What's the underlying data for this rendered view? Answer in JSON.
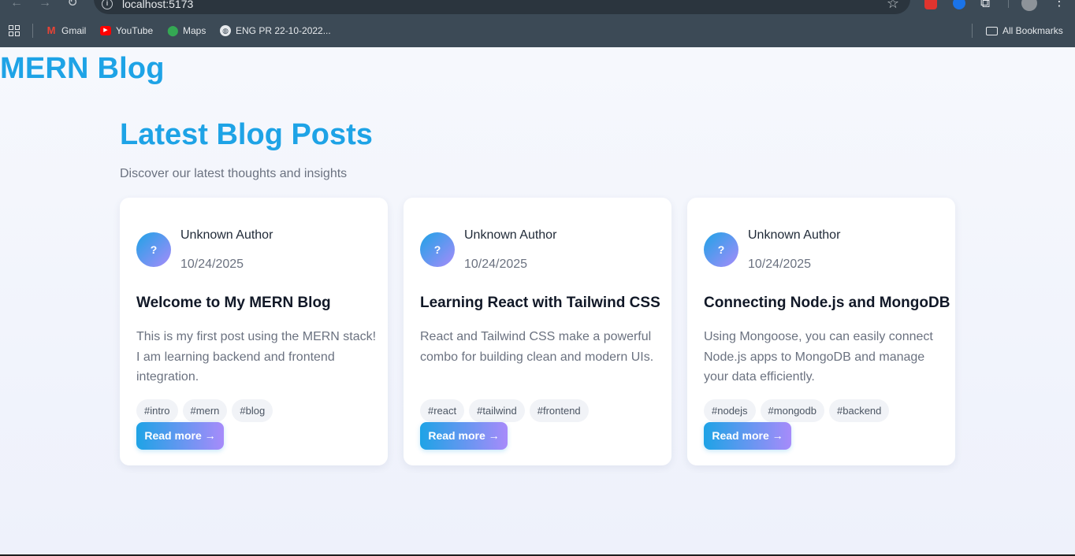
{
  "browser": {
    "url": "localhost:5173",
    "bookmarks": [
      {
        "label": "Gmail",
        "icon": "gmail-icon"
      },
      {
        "label": "YouTube",
        "icon": "youtube-icon"
      },
      {
        "label": "Maps",
        "icon": "maps-icon"
      },
      {
        "label": "ENG PR 22-10-2022...",
        "icon": "globe-icon"
      }
    ],
    "all_bookmarks_label": "All Bookmarks"
  },
  "site": {
    "brand": "MERN Blog",
    "heading": "Latest Blog Posts",
    "subtitle": "Discover our latest thoughts and insights",
    "accent_color": "#1ea3e6",
    "gradient_end_color": "#a78bfa"
  },
  "posts": [
    {
      "avatar_initial": "?",
      "author": "Unknown Author",
      "date": "10/24/2025",
      "title": "Welcome to My MERN Blog",
      "excerpt": "This is my first post using the MERN stack! I am learning backend and frontend integration.",
      "tags": [
        "#intro",
        "#mern",
        "#blog"
      ],
      "cta": "Read more →"
    },
    {
      "avatar_initial": "?",
      "author": "Unknown Author",
      "date": "10/24/2025",
      "title": "Learning React with Tailwind CSS",
      "excerpt": "React and Tailwind CSS make a powerful combo for building clean and modern UIs.",
      "tags": [
        "#react",
        "#tailwind",
        "#frontend"
      ],
      "cta": "Read more →"
    },
    {
      "avatar_initial": "?",
      "author": "Unknown Author",
      "date": "10/24/2025",
      "title": "Connecting Node.js and MongoDB",
      "excerpt": "Using Mongoose, you can easily connect Node.js apps to MongoDB and manage your data efficiently.",
      "tags": [
        "#nodejs",
        "#mongodb",
        "#backend"
      ],
      "cta": "Read more →"
    }
  ]
}
